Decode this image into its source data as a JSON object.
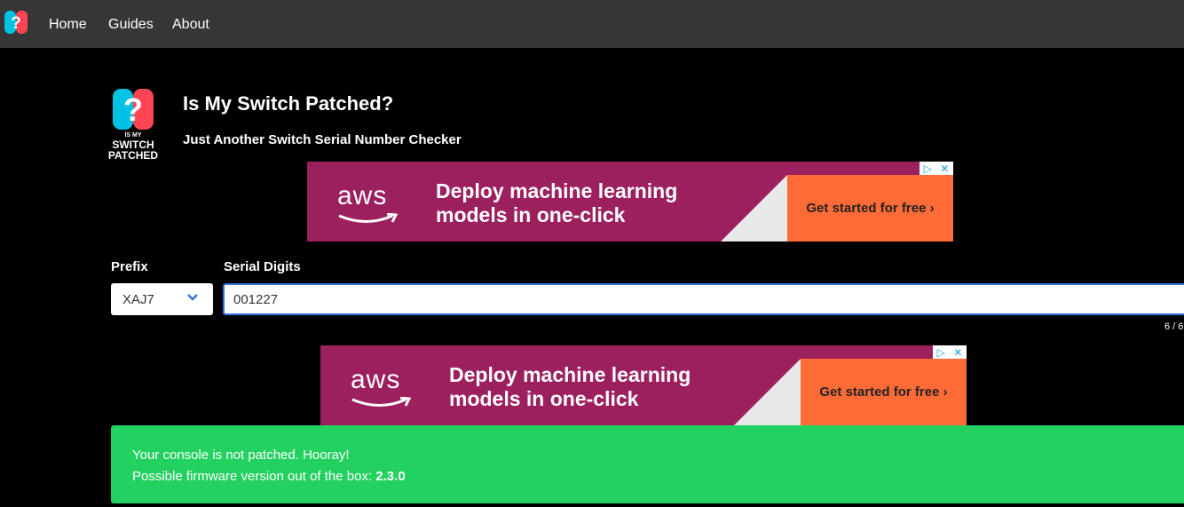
{
  "nav": {
    "links": [
      "Home",
      "Guides",
      "About"
    ],
    "logo_icon": "switch-question-icon"
  },
  "header": {
    "logo_text_line1": "IS MY",
    "logo_text_line2": "SWITCH",
    "logo_text_line3": "PATCHED",
    "title": "Is My Switch Patched?",
    "subtitle": "Just Another Switch Serial Number Checker"
  },
  "ads": [
    {
      "brand": "aws",
      "headline": "Deploy machine learning models in one-click",
      "cta": "Get started for free ›"
    },
    {
      "brand": "aws",
      "headline": "Deploy machine learning models in one-click",
      "cta": "Get started for free ›"
    }
  ],
  "form": {
    "prefix_label": "Prefix",
    "prefix_value": "XAJ7",
    "serial_label": "Serial Digits",
    "serial_value": "001227",
    "counter": "6 / 6"
  },
  "result": {
    "line1": "Your console is not patched. Hooray!",
    "line2_prefix": "Possible firmware version out of the box:",
    "firmware": "2.3.0"
  },
  "colors": {
    "navbar": "#363636",
    "success": "#23d160",
    "ad_bg": "#9c1f5e",
    "ad_cta": "#ff6b36",
    "joycon_blue": "#00c3e3",
    "joycon_red": "#ff4554"
  }
}
